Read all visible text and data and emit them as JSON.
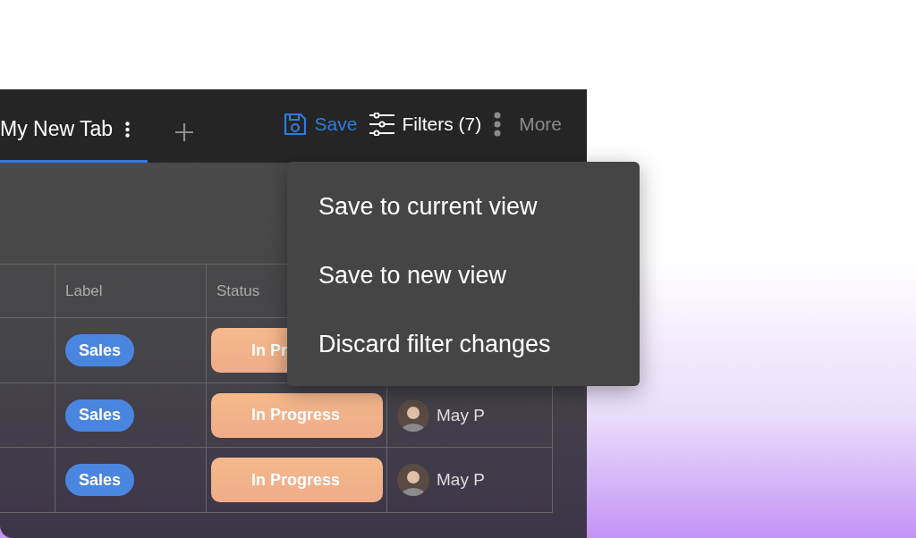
{
  "tabs": [
    {
      "label": "My New Tab",
      "selected": true
    }
  ],
  "toolbar": {
    "save": "Save",
    "filters": "Filters (7)",
    "more": "More"
  },
  "table": {
    "columns": [
      {
        "label": "Label"
      },
      {
        "label": "Status"
      }
    ],
    "rows": [
      {
        "label": "Sales",
        "status": "In Pr"
      },
      {
        "label": "Sales",
        "status": "In Progress",
        "person": "May P"
      },
      {
        "label": "Sales",
        "status": "In Progress",
        "person": "May P"
      }
    ]
  },
  "menu": {
    "items": [
      "Save to current view",
      "Save to new view",
      "Discard filter changes"
    ]
  }
}
